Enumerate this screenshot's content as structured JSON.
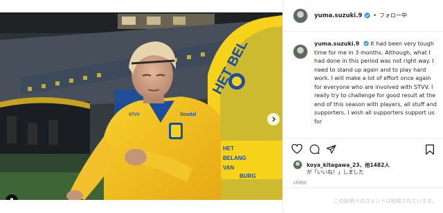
{
  "post": {
    "username": "yuma.suzuki.9",
    "separator": "•",
    "follow_state": "フォロー中",
    "more_glyph": "···"
  },
  "caption": {
    "username": "yuma.suzuki.9",
    "text": "It had been very tough time for me in 3 months. Although, what I had done in this period was not right way. I need to stand up again and to play hard work. I will make a lot of effort once again for everyone who are involved with STVV. I really try to challenge for good result at the end of this season with players, all stuff and supporters. I wish all supporters support us for"
  },
  "likes": {
    "liker": "koya_kitagawa_23",
    "others": "、他1482人",
    "line2": "が「いいね！」しました"
  },
  "time_ago": "1時間前",
  "comments_disabled": "この投稿へのコメントは制限されています。",
  "photo_banner": {
    "line1": "HET BEL",
    "sub": "HET BELANG VAN LIMBURG"
  },
  "carousel": {
    "count": 2,
    "active": 1
  },
  "icons": {
    "heart": "heart-icon",
    "comment": "comment-icon",
    "share": "share-icon",
    "save": "bookmark-icon",
    "verified": "verified-badge-icon",
    "next": "chevron-right-icon",
    "user_tag": "user-tag-icon"
  },
  "colors": {
    "accent": "#3897f0",
    "jersey": "#f4c21b",
    "banner_blue": "#1c4e9d",
    "banner_yellow": "#f6d21a"
  }
}
